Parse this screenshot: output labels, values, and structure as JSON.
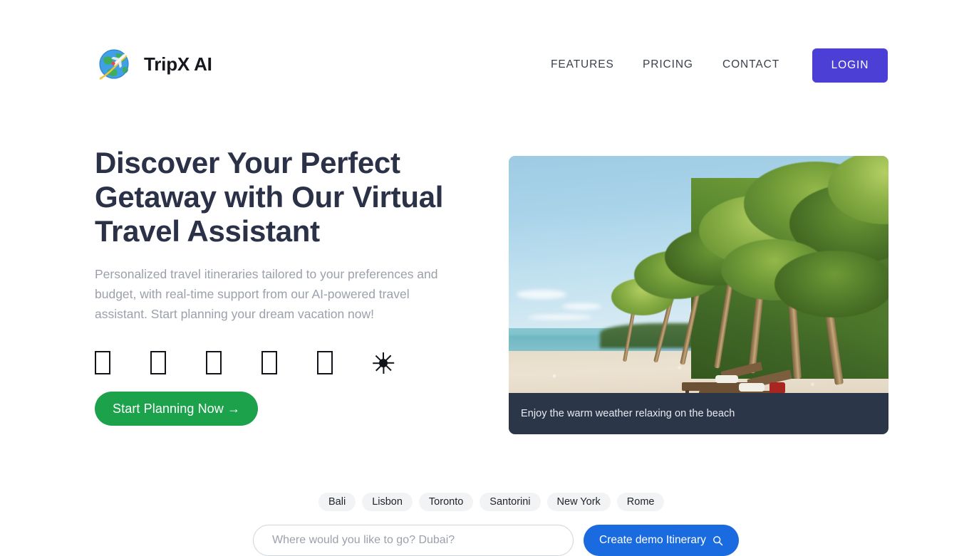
{
  "brand": {
    "name": "TripX AI",
    "logo_icon": "globe-airplane-icon"
  },
  "nav": {
    "links": [
      {
        "label": "FEATURES"
      },
      {
        "label": "PRICING"
      },
      {
        "label": "CONTACT"
      }
    ],
    "login_label": "LOGIN",
    "login_color": "#4b3fd6"
  },
  "hero": {
    "headline": "Discover Your Perfect Getaway with Our Virtual Travel Assistant",
    "subtitle": "Personalized travel itineraries tailored to your preferences and budget, with real-time support from our AI-powered travel assistant. Start planning your dream vacation now!",
    "headline_color": "#2b3248",
    "subtitle_color": "#9ba0ab",
    "icons": [
      {
        "name": "missing-glyph-1",
        "glyph": ""
      },
      {
        "name": "missing-glyph-2",
        "glyph": ""
      },
      {
        "name": "missing-glyph-3",
        "glyph": ""
      },
      {
        "name": "missing-glyph-4",
        "glyph": ""
      },
      {
        "name": "missing-glyph-5",
        "glyph": ""
      },
      {
        "name": "sun-icon",
        "glyph": "☀"
      }
    ],
    "cta_label": "Start Planning Now →",
    "cta_color": "#1ba24b"
  },
  "hero_image": {
    "caption": "Enjoy the warm weather relaxing on the beach",
    "caption_bg": "#2b3648",
    "alt": "tropical beach with palm trees and sun loungers"
  },
  "destinations": {
    "chips": [
      {
        "label": "Bali"
      },
      {
        "label": "Lisbon"
      },
      {
        "label": "Toronto"
      },
      {
        "label": "Santorini"
      },
      {
        "label": "New York"
      },
      {
        "label": "Rome"
      }
    ],
    "chip_bg": "#f1f3f5"
  },
  "search": {
    "placeholder": "Where would you like to go? Dubai?",
    "value": "",
    "button_label": "Create demo Itinerary",
    "button_icon": "search-icon",
    "button_color": "#1a6ae0"
  }
}
